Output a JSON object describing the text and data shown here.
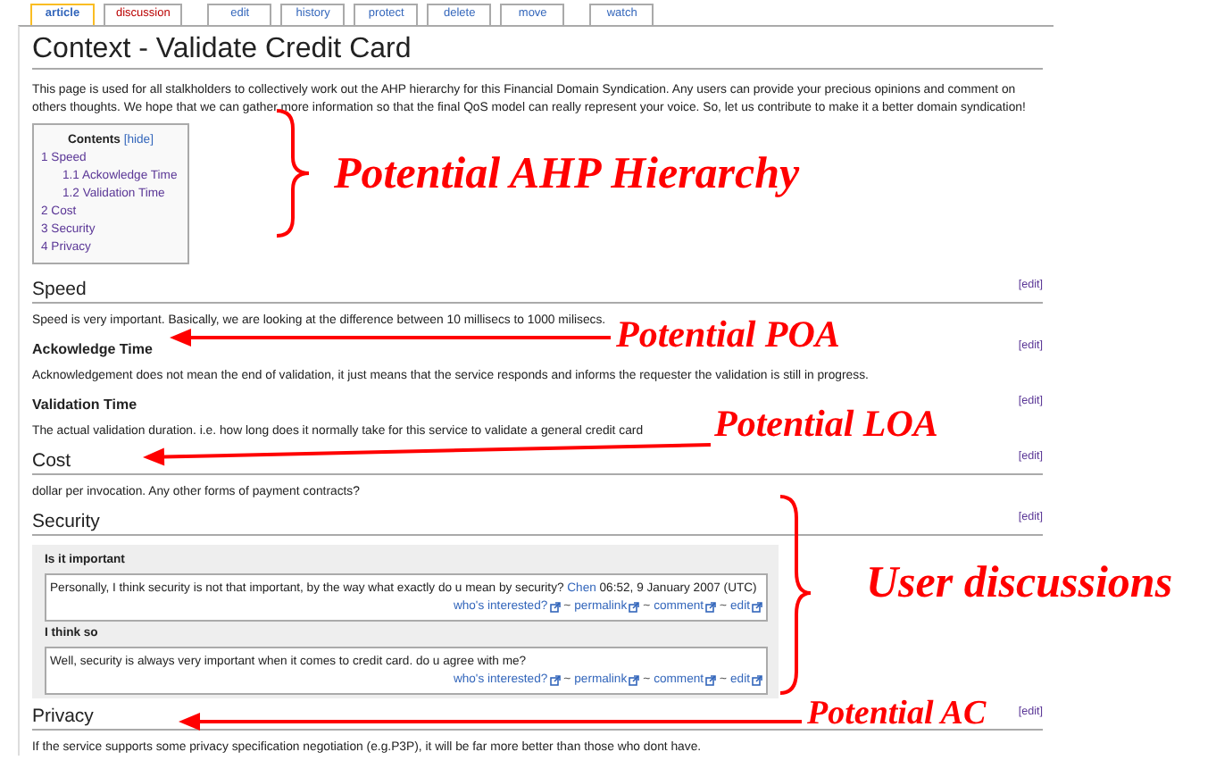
{
  "tab_groups": [
    [
      {
        "label": "article",
        "selected": true,
        "page_exists": true
      },
      {
        "label": "discussion",
        "selected": false,
        "page_exists": false
      }
    ],
    [
      {
        "label": "edit",
        "selected": false,
        "page_exists": true
      },
      {
        "label": "history",
        "selected": false,
        "page_exists": true
      },
      {
        "label": "protect",
        "selected": false,
        "page_exists": true
      },
      {
        "label": "delete",
        "selected": false,
        "page_exists": true
      },
      {
        "label": "move",
        "selected": false,
        "page_exists": true
      }
    ],
    [
      {
        "label": "watch",
        "selected": false,
        "page_exists": true
      }
    ]
  ],
  "title": "Context - Validate Credit Card",
  "intro": "This page is used for all stalkholders to collectively work out the AHP hierarchy for this Financial Domain Syndication. Any users can provide your precious opinions and comment on others thoughts. We hope that we can gather more information so that the final QoS model can really represent your voice. So, let us contribute to make it a better domain syndication!",
  "toc": {
    "title": "Contents",
    "toggle": "[hide]",
    "items": [
      {
        "number": "1",
        "label": "Speed",
        "children": [
          {
            "number": "1.1",
            "label": "Ackowledge Time"
          },
          {
            "number": "1.2",
            "label": "Validation Time"
          }
        ]
      },
      {
        "number": "2",
        "label": "Cost"
      },
      {
        "number": "3",
        "label": "Security"
      },
      {
        "number": "4",
        "label": "Privacy"
      }
    ]
  },
  "sections": [
    {
      "kind": "h2",
      "heading": "Speed",
      "edit": "[edit]",
      "body": "Speed is very important. Basically, we are looking at the difference between 10 millisecs to 1000 milisecs."
    },
    {
      "kind": "h3",
      "heading": "Ackowledge Time",
      "edit": "[edit]",
      "body": "Acknowledgement does not mean the end of validation, it just means that the service responds and informs the requester the validation is still in progress."
    },
    {
      "kind": "h3",
      "heading": "Validation Time",
      "edit": "[edit]",
      "body": "The actual validation duration. i.e. how long does it normally take for this service to validate a general credit card"
    },
    {
      "kind": "h2",
      "heading": "Cost",
      "edit": "[edit]",
      "body": "dollar per invocation. Any other forms of payment contracts?"
    },
    {
      "kind": "h2",
      "heading": "Security",
      "edit": "[edit]",
      "threads": [
        {
          "title": "Is it important",
          "text": "Personally, I think security is not that important, by the way what exactly do u mean by security?",
          "author": "Chen",
          "date": "06:52, 9 January 2007 (UTC)",
          "links": [
            {
              "label": "who's interested?"
            },
            {
              "prefix": "~",
              "label": "permalink"
            },
            {
              "prefix": "~",
              "label": "comment"
            },
            {
              "prefix": "~",
              "label": "edit"
            }
          ]
        },
        {
          "title": "I think so",
          "text": "Well, security is always very important when it comes to credit card. do u agree with me?",
          "links": [
            {
              "label": "who's interested?"
            },
            {
              "prefix": "~",
              "label": "permalink"
            },
            {
              "prefix": "~",
              "label": "comment"
            },
            {
              "prefix": "~",
              "label": "edit"
            }
          ]
        }
      ]
    },
    {
      "kind": "h2",
      "heading": "Privacy",
      "edit": "[edit]",
      "body": "If the service supports some privacy specification negotiation (e.g.P3P), it will be far more better than those who dont have."
    }
  ],
  "annotations": [
    "Potential AHP Hierarchy",
    "Potential POA",
    "Potential LOA",
    "User discussions",
    "Potential AC"
  ]
}
